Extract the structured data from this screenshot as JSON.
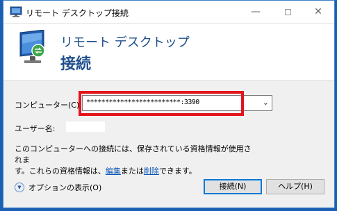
{
  "window": {
    "title": "リモート デスクトップ接続",
    "minimize_glyph": "—",
    "close_glyph": "✕"
  },
  "header": {
    "line1": "リモート デスクトップ",
    "line2": "接続"
  },
  "form": {
    "computer_label": "コンピューター(C):",
    "computer_value": "*************************:3390",
    "computer_dropdown_glyph": "⌄",
    "username_label": "ユーザー名:",
    "username_value": ""
  },
  "info": {
    "line1": "このコンピューターへの接続には、保存されている資格情報が使用されま",
    "line2_prefix": "す。これらの資格情報は、",
    "edit_link": "編集",
    "middle": "または",
    "delete_link": "削除",
    "suffix": "できます。"
  },
  "footer": {
    "options_label": "オプションの表示(O)",
    "connect_label": "接続(N)",
    "help_label": "ヘルプ(H)"
  },
  "colors": {
    "accent": "#1e4e8c",
    "highlight": "#e3141c",
    "link": "#0a55b6"
  }
}
